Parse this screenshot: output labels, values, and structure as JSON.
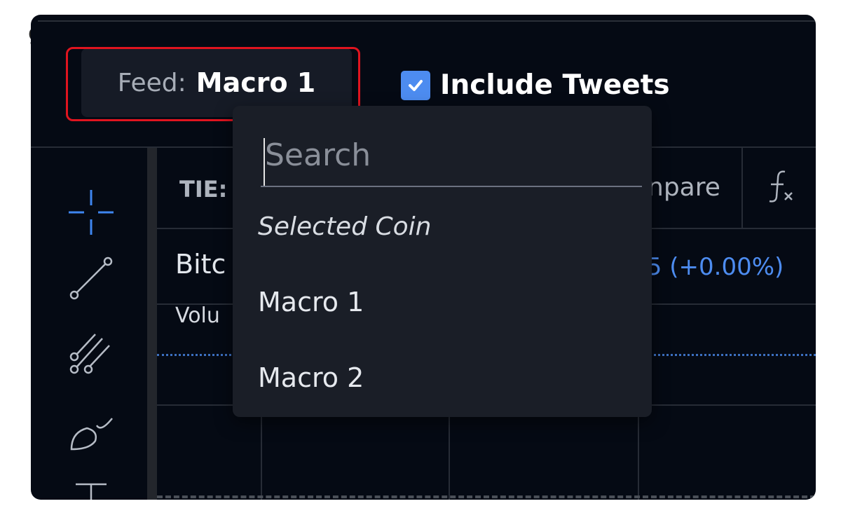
{
  "feed_selector": {
    "label": "Feed:",
    "value": "Macro 1"
  },
  "include_tweets": {
    "label": "Include Tweets",
    "checked": true
  },
  "symbol_bar": {
    "symbol_partial": "TIE:",
    "compare_partial": "npare",
    "indicator_icon": "fx"
  },
  "legend": {
    "title_partial": "Bitc",
    "change_partial": ".5 (+0.00%)",
    "volume_partial": "Volu"
  },
  "dropdown": {
    "search_placeholder": "Search",
    "section_label": "Selected Coin",
    "items": [
      "Macro 1",
      "Macro 2"
    ]
  },
  "left_tools": [
    "crosshair-icon",
    "trend-line-icon",
    "pitchfork-icon",
    "brush-icon",
    "text-tool-icon"
  ],
  "colors": {
    "accent": "#4d8cf0",
    "highlight": "#e0141f",
    "panel": "#050a14",
    "dropdown": "#1a1e27"
  }
}
